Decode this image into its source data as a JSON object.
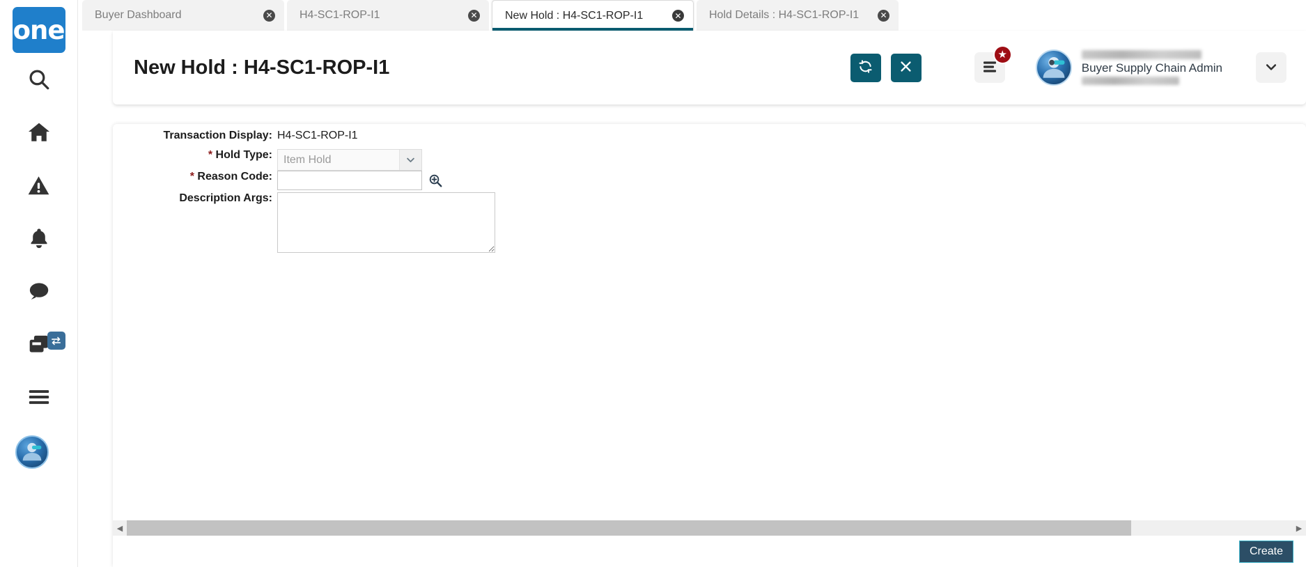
{
  "brand": {
    "logo_text": "one"
  },
  "sidebar": {
    "items": [
      {
        "name": "search",
        "icon": "search-icon"
      },
      {
        "name": "home",
        "icon": "home-icon"
      },
      {
        "name": "alerts",
        "icon": "warning-triangle-icon"
      },
      {
        "name": "notifications",
        "icon": "bell-icon"
      },
      {
        "name": "messages",
        "icon": "chat-bubble-icon"
      },
      {
        "name": "windows",
        "icon": "windows-copy-icon",
        "badge_icon": "swap-arrows-icon"
      },
      {
        "name": "menu",
        "icon": "hamburger-menu-icon"
      }
    ],
    "avatar": {
      "icon": "user-avatar-icon"
    }
  },
  "tabs": [
    {
      "label": "Buyer Dashboard",
      "active": false,
      "close_icon": "close-circle-icon"
    },
    {
      "label": "H4-SC1-ROP-I1",
      "active": false,
      "close_icon": "close-circle-icon"
    },
    {
      "label": "New Hold : H4-SC1-ROP-I1",
      "active": true,
      "close_icon": "close-circle-icon"
    },
    {
      "label": "Hold Details : H4-SC1-ROP-I1",
      "active": false,
      "close_icon": "close-circle-icon"
    }
  ],
  "header": {
    "title": "New Hold : H4-SC1-ROP-I1",
    "refresh_icon": "refresh-sync-icon",
    "close_icon": "close-x-icon",
    "list_menu_icon": "list-menu-icon",
    "star_badge_icon": "star-icon",
    "star_badge_glyph": "★",
    "user": {
      "role": "Buyer Supply Chain Admin",
      "name_redacted": true,
      "id_redacted": true
    },
    "caret_icon": "chevron-down-icon"
  },
  "form": {
    "rows": {
      "transaction_display": {
        "label": "Transaction Display:",
        "value": "H4-SC1-ROP-I1"
      },
      "hold_type": {
        "label": "Hold Type:",
        "required_marker": "*",
        "value": "Item Hold",
        "arrow_icon": "chevron-down-icon"
      },
      "reason_code": {
        "label": "Reason Code:",
        "required_marker": "*",
        "value": "",
        "placeholder": "",
        "lookup_icon": "magnifier-plus-icon"
      },
      "description_args": {
        "label": "Description Args:",
        "value": "",
        "placeholder": ""
      }
    }
  },
  "scrollbar": {
    "left_arrow_icon": "triangle-left-icon",
    "right_arrow_icon": "triangle-right-icon",
    "left_glyph": "◀",
    "right_glyph": "▶"
  },
  "footer": {
    "create_label": "Create"
  },
  "colors": {
    "brand_blue": "#1F7FCB",
    "teal_accent": "#0B5C70",
    "badge_red": "#9E0D14",
    "swap_badge_blue": "#3A6E99",
    "create_bg": "#2C4E66",
    "create_border": "#3BB3C9",
    "required_star": "#8B1A1A",
    "tab_inactive_bg": "#F2F2F2",
    "scroll_thumb": "#C2C2C2"
  }
}
